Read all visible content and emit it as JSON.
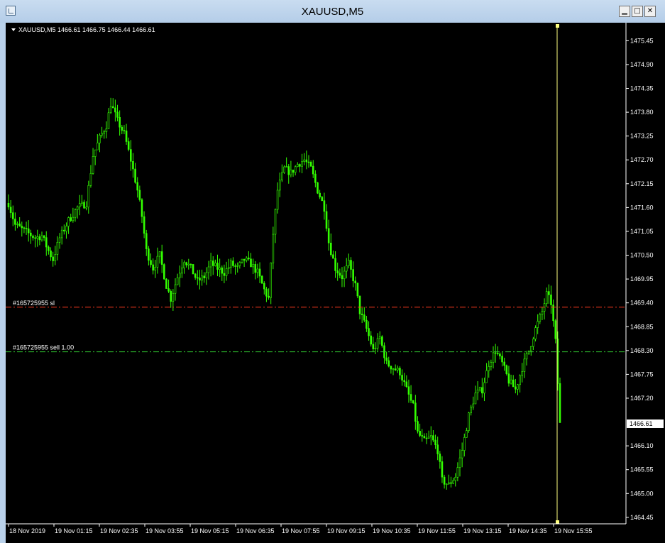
{
  "window": {
    "title": "XAUUSD,M5",
    "minimize_glyph": "▁",
    "maximize_glyph": "□",
    "close_glyph": "✕"
  },
  "chart_data": {
    "type": "candlestick",
    "symbol_header": "XAUUSD,M5  1466.61 1466.75 1466.44 1466.61",
    "current_price_label": "1466.61",
    "current_price": 1466.61,
    "ylim": [
      1464.3,
      1475.8
    ],
    "y_ticks": [
      "1475.45",
      "1474.90",
      "1474.35",
      "1473.80",
      "1473.25",
      "1472.70",
      "1472.15",
      "1471.60",
      "1471.05",
      "1470.50",
      "1469.95",
      "1469.40",
      "1468.85",
      "1468.30",
      "1467.75",
      "1467.20",
      "1466.10",
      "1465.55",
      "1465.00",
      "1464.45"
    ],
    "x_ticks": [
      "18 Nov 2019",
      "19 Nov 01:15",
      "19 Nov 02:35",
      "19 Nov 03:55",
      "19 Nov 05:15",
      "19 Nov 06:35",
      "19 Nov 07:55",
      "19 Nov 09:15",
      "19 Nov 10:35",
      "19 Nov 11:55",
      "19 Nov 13:15",
      "19 Nov 14:35",
      "19 Nov 15:55"
    ],
    "order_lines": [
      {
        "label": "#165725955 sl",
        "price": 1469.3,
        "color": "#ff3b1f"
      },
      {
        "label": "#165725955 sell 1.00",
        "price": 1468.27,
        "color": "#2fc22f"
      }
    ],
    "cursor_line_color": "#ffff80",
    "candle_color": "#33ff00",
    "background": "#000000",
    "grid": false,
    "price_path": [
      [
        0,
        1471.7
      ],
      [
        3,
        1471.2
      ],
      [
        6,
        1471.1
      ],
      [
        9,
        1471.0
      ],
      [
        12,
        1470.9
      ],
      [
        15,
        1470.95
      ],
      [
        18,
        1470.6
      ],
      [
        20,
        1470.4
      ],
      [
        23,
        1470.9
      ],
      [
        27,
        1471.3
      ],
      [
        31,
        1471.6
      ],
      [
        35,
        1471.7
      ],
      [
        38,
        1472.8
      ],
      [
        41,
        1473.2
      ],
      [
        44,
        1473.5
      ],
      [
        46,
        1474.0
      ],
      [
        49,
        1473.6
      ],
      [
        52,
        1473.3
      ],
      [
        55,
        1472.7
      ],
      [
        58,
        1472.0
      ],
      [
        60,
        1471.4
      ],
      [
        62,
        1470.6
      ],
      [
        65,
        1470.2
      ],
      [
        68,
        1470.5
      ],
      [
        71,
        1469.8
      ],
      [
        73,
        1469.5
      ],
      [
        76,
        1470.0
      ],
      [
        79,
        1470.4
      ],
      [
        82,
        1470.2
      ],
      [
        85,
        1469.9
      ],
      [
        88,
        1470.0
      ],
      [
        91,
        1470.3
      ],
      [
        94,
        1470.2
      ],
      [
        97,
        1470.1
      ],
      [
        100,
        1470.3
      ],
      [
        103,
        1470.2
      ],
      [
        106,
        1470.4
      ],
      [
        109,
        1470.3
      ],
      [
        112,
        1470.1
      ],
      [
        115,
        1469.7
      ],
      [
        117,
        1469.5
      ],
      [
        119,
        1471.0
      ],
      [
        121,
        1472.0
      ],
      [
        124,
        1472.5
      ],
      [
        127,
        1472.4
      ],
      [
        130,
        1472.6
      ],
      [
        133,
        1472.7
      ],
      [
        136,
        1472.5
      ],
      [
        139,
        1472.0
      ],
      [
        142,
        1471.6
      ],
      [
        144,
        1470.8
      ],
      [
        147,
        1470.2
      ],
      [
        150,
        1470.0
      ],
      [
        153,
        1470.3
      ],
      [
        156,
        1469.8
      ],
      [
        158,
        1469.2
      ],
      [
        161,
        1468.8
      ],
      [
        164,
        1468.3
      ],
      [
        167,
        1468.6
      ],
      [
        170,
        1468.0
      ],
      [
        173,
        1467.9
      ],
      [
        176,
        1467.8
      ],
      [
        179,
        1467.4
      ],
      [
        182,
        1467.0
      ],
      [
        184,
        1466.4
      ],
      [
        187,
        1466.2
      ],
      [
        190,
        1466.3
      ],
      [
        193,
        1466.0
      ],
      [
        195,
        1465.3
      ],
      [
        198,
        1465.2
      ],
      [
        201,
        1465.4
      ],
      [
        204,
        1466.0
      ],
      [
        207,
        1466.8
      ],
      [
        210,
        1467.3
      ],
      [
        213,
        1467.4
      ],
      [
        216,
        1468.0
      ],
      [
        219,
        1468.3
      ],
      [
        222,
        1468.0
      ],
      [
        225,
        1467.6
      ],
      [
        228,
        1467.4
      ],
      [
        231,
        1467.9
      ],
      [
        234,
        1468.3
      ],
      [
        237,
        1468.8
      ],
      [
        240,
        1469.2
      ],
      [
        242,
        1469.6
      ],
      [
        244,
        1469.4
      ],
      [
        246,
        1468.5
      ],
      [
        248,
        1466.6
      ]
    ]
  }
}
